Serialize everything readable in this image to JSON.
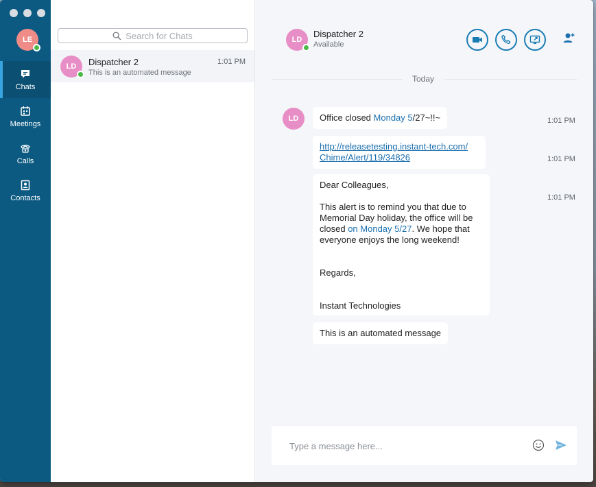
{
  "user": {
    "initials": "LE"
  },
  "nav": [
    {
      "label": "Chats",
      "icon": "chat-icon"
    },
    {
      "label": "Meetings",
      "icon": "calendar-icon"
    },
    {
      "label": "Calls",
      "icon": "phone-icon"
    },
    {
      "label": "Contacts",
      "icon": "contact-card-icon"
    }
  ],
  "search": {
    "placeholder": "Search for Chats",
    "icon": "search-icon"
  },
  "chat_list": [
    {
      "initials": "LD",
      "name": "Dispatcher 2",
      "preview": "This is an automated message",
      "time": "1:01 PM"
    }
  ],
  "conversation": {
    "initials": "LD",
    "name": "Dispatcher 2",
    "status": "Available",
    "actions": [
      "video-icon",
      "phone-icon",
      "screen-share-icon",
      "add-person-icon"
    ],
    "date_divider": "Today",
    "messages": [
      {
        "time": "1:01 PM",
        "parts": [
          "Office closed ",
          "Monday 5",
          "/27~!!~"
        ]
      },
      {
        "time": "1:01 PM",
        "link_line1": "http://releasetesting.instant-tech.com/",
        "link_line2": "Chime/Alert/119/34826"
      },
      {
        "time": "1:01 PM",
        "greeting": "Dear Colleagues,",
        "body_start": "This alert is to remind you that due to Memorial Day holiday, the office will be closed ",
        "body_highlight": "on Monday 5/27",
        "body_end": ". We hope that everyone enjoys the long weekend!",
        "closing": "Regards,",
        "signature": "Instant Technologies"
      },
      {
        "time": "",
        "text": "This is an automated message"
      }
    ]
  },
  "composer": {
    "placeholder": "Type a message here...",
    "icons": [
      "emoji-icon",
      "send-icon"
    ]
  },
  "colors": {
    "rail": "#0c5a82",
    "rail_active_indicator": "#37a3df",
    "accent": "#1a7cb5",
    "presence_available": "#49b947",
    "avatar_user": "#f08c88",
    "avatar_contact": "#e88ec6"
  }
}
